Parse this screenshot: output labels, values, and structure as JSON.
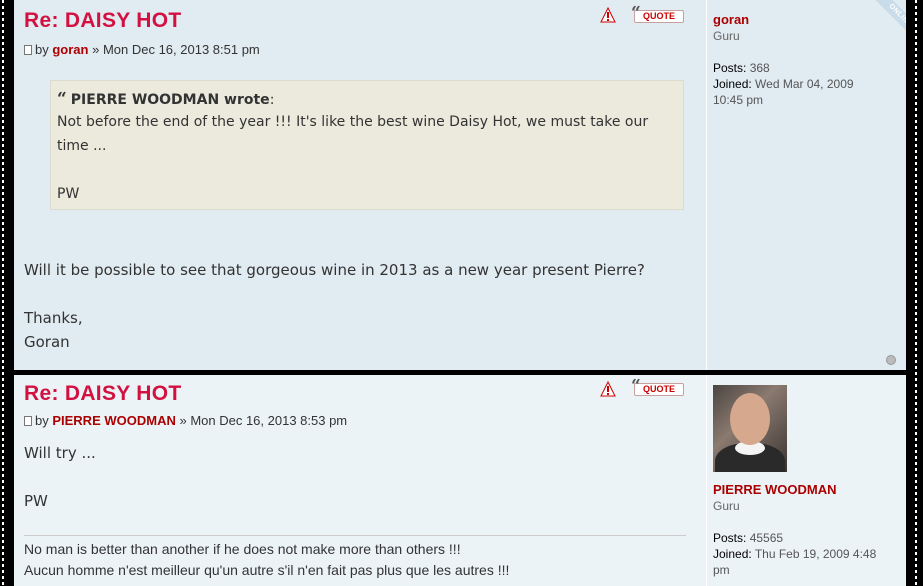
{
  "posts": [
    {
      "title": "Re: DAISY HOT",
      "by_prefix": "by ",
      "author": "goran",
      "date_sep": " » ",
      "date": "Mon Dec 16, 2013 8:51 pm",
      "quote_button": "QUOTE",
      "quote": {
        "cite": "PIERRE WOODMAN wrote",
        "cite_suffix": ":",
        "line1": "Not before the end of the year !!! It's like the best wine Daisy Hot, we must take our",
        "line2": "time ...",
        "line3": "PW"
      },
      "body": [
        "Will it be possible to see that gorgeous wine in 2013 as a new year present Pierre?",
        "Thanks,",
        "Goran"
      ],
      "profile": {
        "username": "goran",
        "rank": "Guru",
        "posts_label": "Posts:",
        "posts": "368",
        "joined_label": "Joined:",
        "joined_line1": "Wed Mar 04, 2009",
        "joined_line2": "10:45 pm",
        "online_badge": "ONLINE"
      }
    },
    {
      "title": "Re: DAISY HOT",
      "by_prefix": "by ",
      "author": "PIERRE WOODMAN",
      "date_sep": " » ",
      "date": "Mon Dec 16, 2013 8:53 pm",
      "quote_button": "QUOTE",
      "body": [
        "Will try ...",
        "PW"
      ],
      "signature": [
        "No man is better than another if he does not make more than others !!!",
        "Aucun homme n'est meilleur qu'un autre s'il n'en fait pas plus que les autres !!!"
      ],
      "profile": {
        "username": "PIERRE WOODMAN",
        "rank": "Guru",
        "posts_label": "Posts:",
        "posts": "45565",
        "joined_label": "Joined:",
        "joined_line1": "Thu Feb 19, 2009 4:48",
        "joined_line2": "pm"
      }
    }
  ],
  "icons": {
    "report": "report-icon",
    "quote": "quote-icon",
    "post": "post-icon",
    "top": "back-to-top-icon"
  },
  "colors": {
    "title": "#d31141",
    "author": "#aa0000",
    "post1_bg": "#e1ebf2",
    "post2_bg": "#ecf3f7",
    "quote_bg": "#ebeadd"
  }
}
